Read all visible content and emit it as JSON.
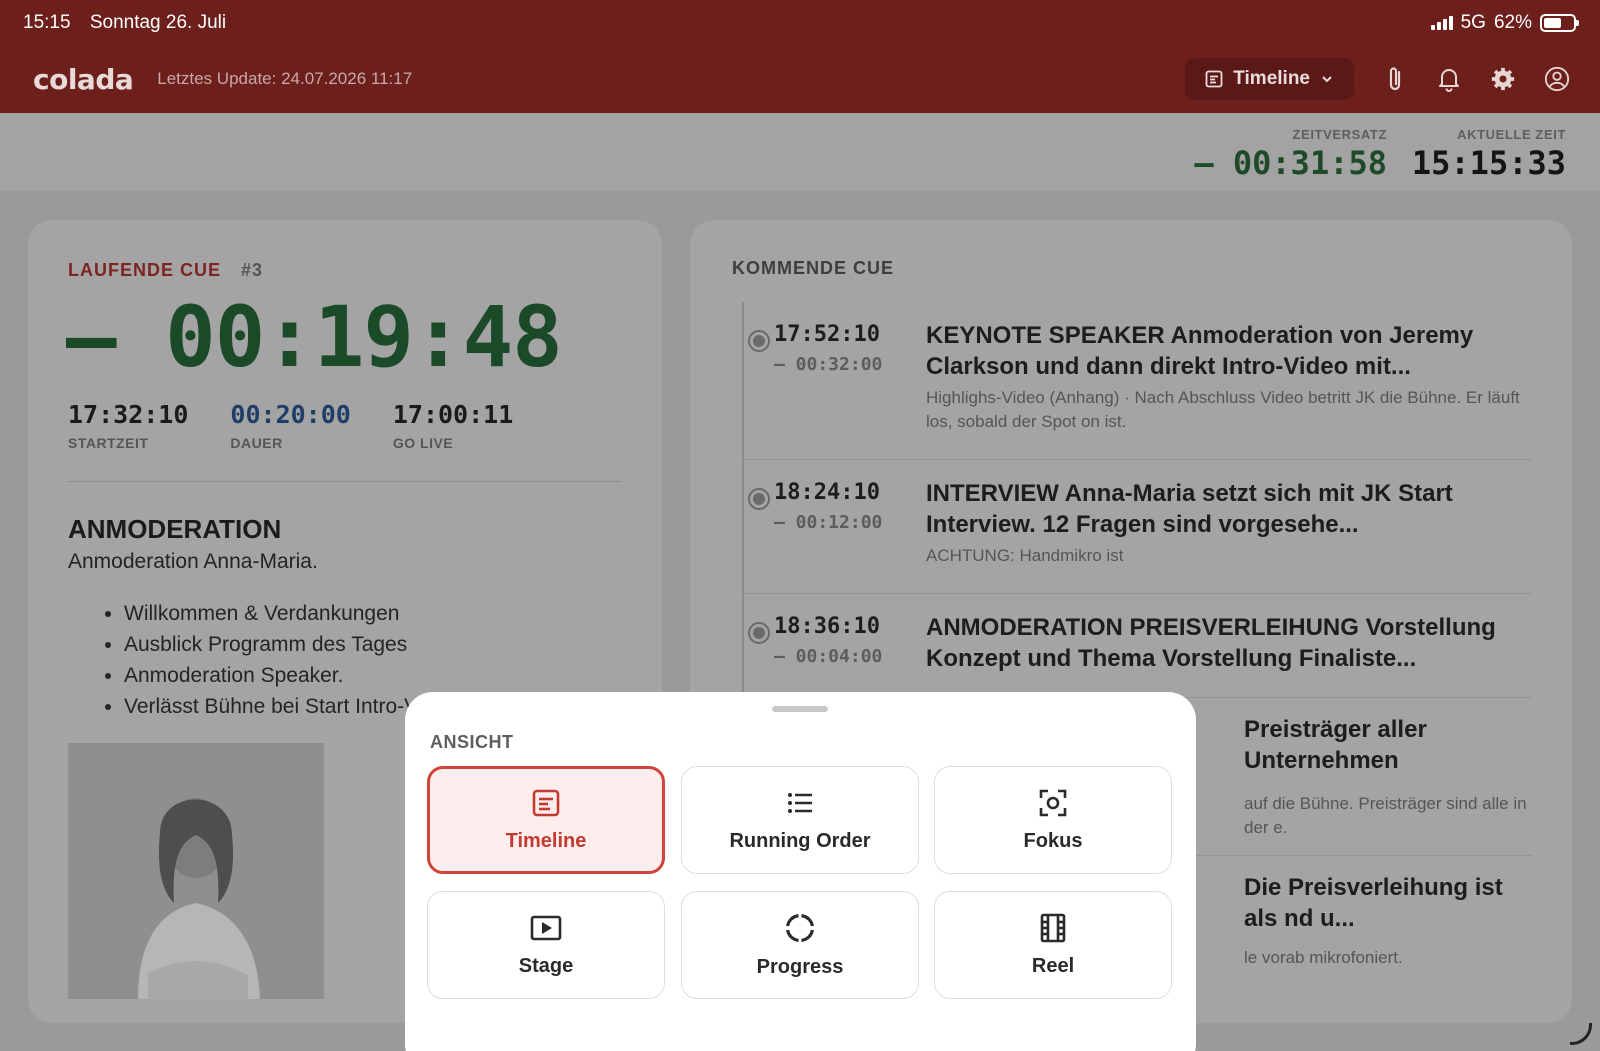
{
  "status": {
    "time": "15:15",
    "date": "Sonntag 26. Juli",
    "network": "5G",
    "battery": "62%",
    "battery_level": 0.62
  },
  "app": {
    "logo": "colada",
    "last_update": "Letztes Update: 24.07.2026 11:17",
    "view_select_label": "Timeline",
    "icons": [
      "attachment-icon",
      "bell-icon",
      "gear-icon",
      "user-icon"
    ]
  },
  "time_header": {
    "offset_label": "ZEITVERSATZ",
    "offset_value": "– 00:31:58",
    "current_label": "AKTUELLE ZEIT",
    "current_value": "15:15:33"
  },
  "running_cue": {
    "label": "LAUFENDE CUE",
    "number": "#3",
    "remaining": "– 00:19:48",
    "start_value": "17:32:10",
    "start_label": "STARTZEIT",
    "duration_value": "00:20:00",
    "duration_label": "DAUER",
    "golive_value": "17:00:11",
    "golive_label": "GO LIVE",
    "title": "ANMODERATION",
    "subtitle": "Anmoderation Anna-Maria.",
    "bullets": [
      "Willkommen & Verdankungen",
      "Ausblick Programm des Tages",
      "Anmoderation Speaker.",
      "Verlässt Bühne bei Start Intro-V"
    ]
  },
  "upcoming": {
    "label": "KOMMENDE CUE",
    "items": [
      {
        "time": "17:52:10",
        "countdown": "– 00:32:00",
        "title": "KEYNOTE SPEAKER Anmoderation von Jeremy Clarkson und dann direkt Intro-Video mit...",
        "note": "Highlighs-Video (Anhang) · Nach Abschluss Video betritt JK die Bühne. Er läuft los, sobald der Spot on ist."
      },
      {
        "time": "18:24:10",
        "countdown": "– 00:12:00",
        "title": "INTERVIEW Anna-Maria setzt sich mit JK Start Interview. 12 Fragen sind vorgesehe...",
        "note": "ACHTUNG: Handmikro ist"
      },
      {
        "time": "18:36:10",
        "countdown": "– 00:04:00",
        "title": "ANMODERATION PREISVERLEIHUNG Vorstellung Konzept und Thema Vorstellung Finaliste...",
        "note": ""
      },
      {
        "time": "",
        "countdown": "",
        "title": "Preisträger aller Unternehmen",
        "note": "auf die Bühne. Preisträger sind alle in der e."
      },
      {
        "time": "",
        "countdown": "",
        "title": "Die Preisverleihung ist als nd u...",
        "note": "le vorab mikrofoniert."
      }
    ]
  },
  "sheet": {
    "label": "ANSICHT",
    "options": [
      {
        "label": "Timeline",
        "icon": "timeline-icon",
        "selected": true
      },
      {
        "label": "Running Order",
        "icon": "list-icon",
        "selected": false
      },
      {
        "label": "Fokus",
        "icon": "focus-icon",
        "selected": false
      },
      {
        "label": "Stage",
        "icon": "play-icon",
        "selected": false
      },
      {
        "label": "Progress",
        "icon": "progress-icon",
        "selected": false
      },
      {
        "label": "Reel",
        "icon": "film-icon",
        "selected": false
      }
    ]
  },
  "colors": {
    "topbar": "#6d1f1c",
    "accent_green": "#1b4a28",
    "accent_red": "#d0443b"
  }
}
